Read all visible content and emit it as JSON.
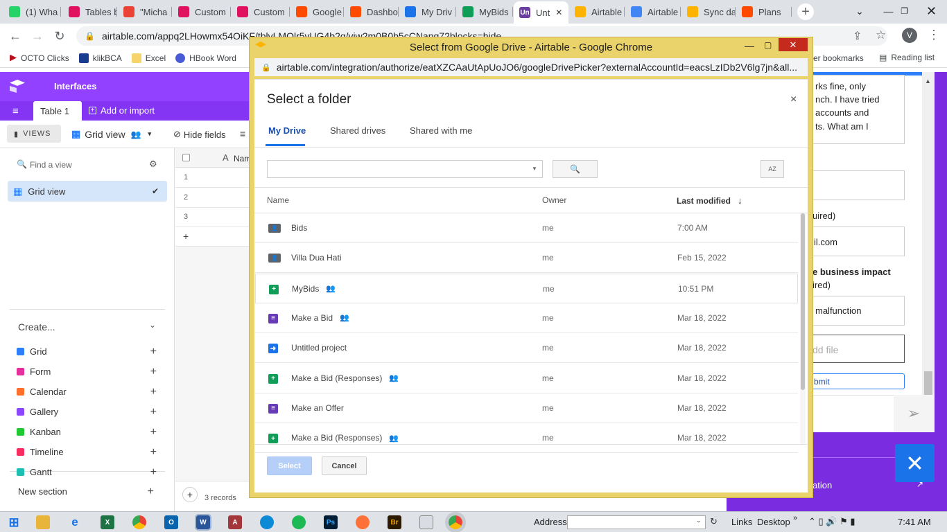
{
  "browser": {
    "tabs": [
      {
        "label": "(1) Wha",
        "color": "#25d366"
      },
      {
        "label": "Tables b",
        "color": "#e0115f"
      },
      {
        "label": "\"Micha",
        "color": "#ea4335"
      },
      {
        "label": "Custom",
        "color": "#e0115f"
      },
      {
        "label": "Custom",
        "color": "#e0115f"
      },
      {
        "label": "Google",
        "color": "#ff4a00"
      },
      {
        "label": "Dashbo",
        "color": "#ff4a00"
      },
      {
        "label": "My Driv",
        "color": "#1a73e8"
      },
      {
        "label": "MyBids",
        "color": "#0f9d58"
      },
      {
        "label": "Unt",
        "color": "#6b3fa0",
        "badge": "Un"
      },
      {
        "label": "Airtable",
        "color": "#fcb400"
      },
      {
        "label": "Airtable",
        "color": "#4285f4"
      },
      {
        "label": "Sync da",
        "color": "#fcb400"
      },
      {
        "label": "Plans",
        "color": "#ff4a00"
      }
    ],
    "url": "airtable.com/appq2LHowmx54OiKF/tblvLMQlr5vUG4b2g/viw2m0B0b5cCNapg72blocks=hide",
    "bookmarks": [
      "OCTO Clicks",
      "klikBCA",
      "Excel",
      "HBook Word"
    ],
    "bookmarks_right": [
      "er bookmarks",
      "Reading list"
    ],
    "profile_initial": "V"
  },
  "airtable": {
    "interfaces_label": "Interfaces",
    "table_tab": "Table 1",
    "add_import": "Add or import",
    "views_label": "VIEWS",
    "grid_view_label": "Grid view",
    "hide_fields": "Hide fields",
    "find_view_placeholder": "Find a view",
    "sidebar_view": "Grid view",
    "create_label": "Create...",
    "create_items": [
      "Grid",
      "Form",
      "Calendar",
      "Gallery",
      "Kanban",
      "Timeline",
      "Gantt"
    ],
    "create_colors": [
      "#2d7ff9",
      "#e62e9c",
      "#ff6f2c",
      "#8b46ff",
      "#20c933",
      "#f82b60",
      "#1dbfb3"
    ],
    "new_section": "New section",
    "column_name": "Nam",
    "rows": [
      "1",
      "2",
      "3"
    ],
    "records_count": "3 records"
  },
  "right_panel": {
    "text_lines": [
      "rks fine, only",
      "nch. I have tried",
      "accounts and",
      "ts. What am I"
    ],
    "required_label": "uired)",
    "email_value": "il.com",
    "business_impact": "e business impact",
    "required_label2": "ired)",
    "malfunction": "malfunction",
    "add_file": "dd file",
    "submit": "bmit",
    "ation_link": "ation"
  },
  "popup": {
    "title": "Select from Google Drive - Airtable - Google Chrome",
    "url": "airtable.com/integration/authorize/eatXZCAaUtApUoJO6/googleDrivePicker?externalAccountId=eacsLzIDb2V6lg7jn&all...",
    "heading": "Select a folder",
    "tabs": [
      "My Drive",
      "Shared drives",
      "Shared with me"
    ],
    "col_name": "Name",
    "col_owner": "Owner",
    "col_modified": "Last modified",
    "rows": [
      {
        "name": "Bids",
        "owner": "me",
        "modified": "7:00 AM",
        "icon": "shared-folder-icon",
        "color": "#5f6368",
        "shared": false
      },
      {
        "name": "Villa Dua Hati",
        "owner": "me",
        "modified": "Feb 15, 2022",
        "icon": "shared-folder-icon",
        "color": "#5f6368",
        "shared": false
      },
      {
        "name": "MyBids",
        "owner": "me",
        "modified": "10:51 PM",
        "icon": "sheets-icon",
        "color": "#0f9d58",
        "shared": true
      },
      {
        "name": "Make a Bid",
        "owner": "me",
        "modified": "Mar 18, 2022",
        "icon": "forms-icon",
        "color": "#673ab7",
        "shared": true
      },
      {
        "name": "Untitled project",
        "owner": "me",
        "modified": "Mar 18, 2022",
        "icon": "apps-script-icon",
        "color": "#1a73e8",
        "shared": false
      },
      {
        "name": "Make a Bid (Responses)",
        "owner": "me",
        "modified": "Mar 18, 2022",
        "icon": "sheets-icon",
        "color": "#0f9d58",
        "shared": true
      },
      {
        "name": "Make an Offer",
        "owner": "me",
        "modified": "Mar 18, 2022",
        "icon": "forms-icon",
        "color": "#673ab7",
        "shared": false
      },
      {
        "name": "Make a Bid (Responses)",
        "owner": "me",
        "modified": "Mar 18, 2022",
        "icon": "sheets-icon",
        "color": "#0f9d58",
        "shared": true
      }
    ],
    "select_button": "Select",
    "cancel_button": "Cancel"
  },
  "taskbar": {
    "address_label": "Address",
    "links_label": "Links",
    "desktop_label": "Desktop",
    "time": "7:41 AM"
  }
}
